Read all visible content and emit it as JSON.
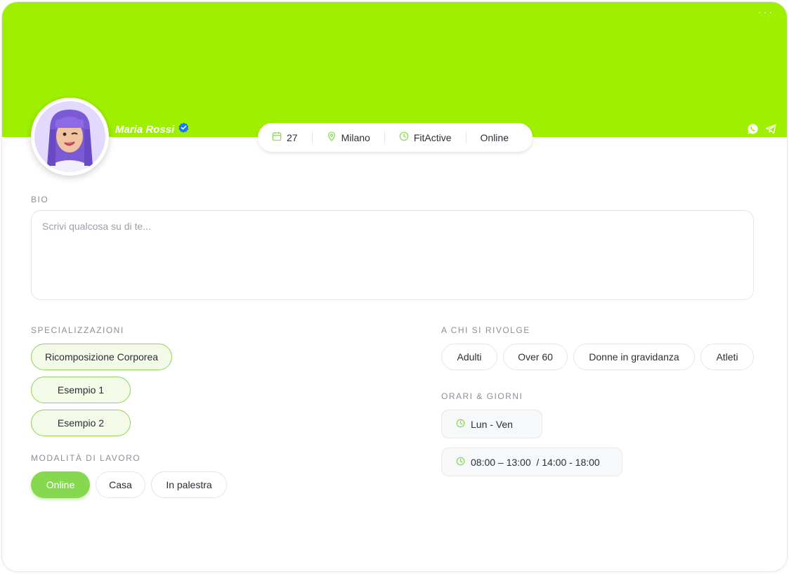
{
  "header": {
    "menu_label": "···",
    "name": "Maria Rossi",
    "verified_icon": "verified-badge-icon",
    "social_icons": [
      "whatsapp-icon",
      "telegram-icon"
    ],
    "cover_color": "#9ff000"
  },
  "meta": {
    "age": "27",
    "city": "Milano",
    "gym": "FitActive",
    "status": "Online"
  },
  "bio": {
    "label": "BIO",
    "placeholder": "Scrivi qualcosa su di te..."
  },
  "specializations": {
    "label": "SPECIALIZZAZIONI",
    "items": [
      "Ricomposizione Corporea",
      "Esempio 1",
      "Esempio 2"
    ]
  },
  "work_mode": {
    "label": "MODALITÀ DI LAVORO",
    "options": [
      "Online",
      "Casa",
      "In palestra"
    ],
    "selected": "Online"
  },
  "audience": {
    "label": "A CHI SI RIVOLGE",
    "items": [
      "Adulti",
      "Over 60",
      "Donne in gravidanza",
      "Atleti"
    ]
  },
  "schedule": {
    "label": "ORARI & GIORNI",
    "days": "Lun - Ven",
    "hours": "08:00 – 13:00  / 14:00 - 18:00"
  },
  "colors": {
    "accent": "#86d84f",
    "accent_light": "#f3fbe8",
    "verified": "#1877f2"
  }
}
